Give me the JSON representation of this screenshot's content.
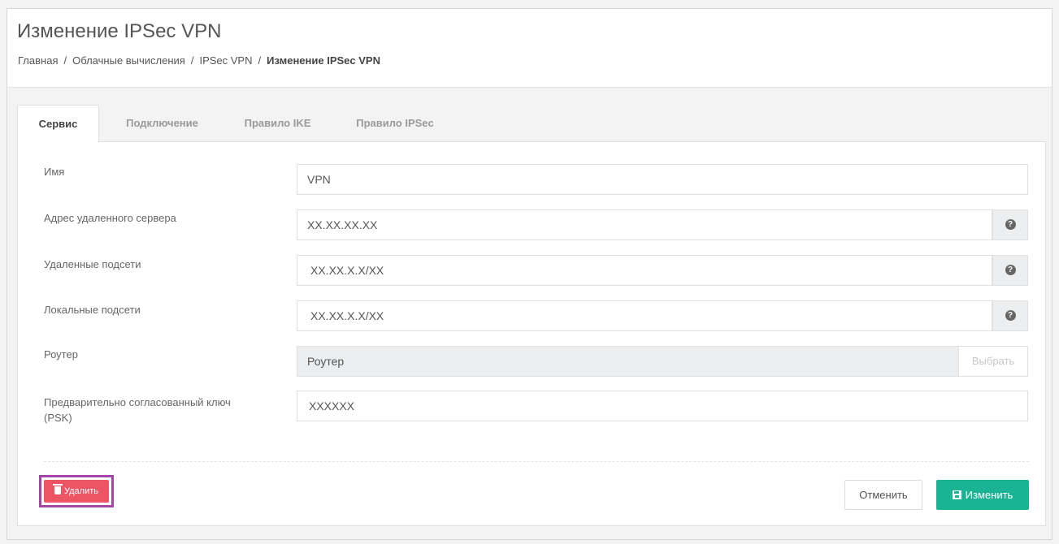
{
  "header": {
    "title": "Изменение IPSec VPN",
    "breadcrumb": [
      "Главная",
      "Облачные вычисления",
      "IPSec VPN",
      "Изменение IPSec VPN"
    ],
    "separator": "/"
  },
  "tabs": [
    "Сервис",
    "Подключение",
    "Правило IKE",
    "Правило IPSec"
  ],
  "form": {
    "name": {
      "label": "Имя",
      "value": "VPN"
    },
    "remote_server": {
      "label": "Адрес удаленного сервера",
      "value": "XX.XX.XX.XX",
      "help_icon": "question-circle-icon",
      "help_glyph": "?"
    },
    "remote_subnets": {
      "label": "Удаленные подсети",
      "value": "XX.XX.X.X/XX",
      "help_icon": "question-circle-icon",
      "help_glyph": "?"
    },
    "local_subnets": {
      "label": "Локальные подсети",
      "value": "XX.XX.X.X/XX",
      "help_icon": "question-circle-icon",
      "help_glyph": "?"
    },
    "router": {
      "label": "Роутер",
      "value": "Роутер",
      "choose_label": "Выбрать"
    },
    "psk": {
      "label_line1": "Предварительно согласованный ключ",
      "label_line2": "(PSK)",
      "value": "XXXXXX"
    }
  },
  "actions": {
    "delete_label": "Удалить",
    "cancel_label": "Отменить",
    "save_label": "Изменить"
  },
  "colors": {
    "accent": "#1ab394",
    "danger": "#ed5565",
    "highlight": "#a346a8"
  }
}
